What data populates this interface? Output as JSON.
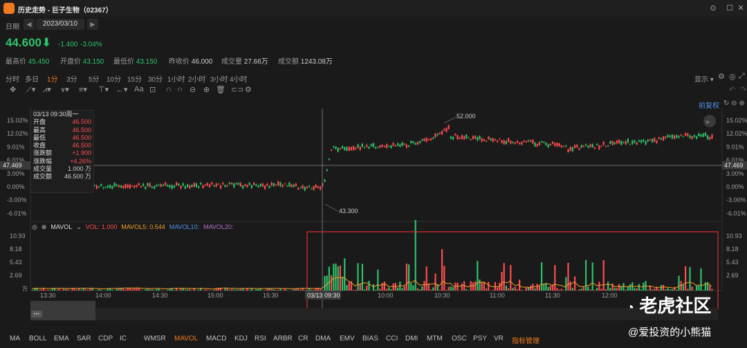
{
  "window": {
    "title": "历史走势 - 巨子生物（02367）"
  },
  "date_bar": {
    "label": "日期",
    "date": "2023/03/10"
  },
  "quote": {
    "price": "44.600",
    "change": "-1.400",
    "change_pct": "-3.04%",
    "stats": [
      {
        "label": "最高价",
        "value": "45.450"
      },
      {
        "label": "开盘价",
        "value": "43.150"
      },
      {
        "label": "最低价",
        "value": "43.150"
      },
      {
        "label": "昨收价",
        "value": "46.000"
      },
      {
        "label": "成交量",
        "value": "27.66万"
      },
      {
        "label": "成交额",
        "value": "1243.08万"
      }
    ]
  },
  "timeframes": [
    "分时",
    "多日",
    "1分",
    "3分",
    "5分",
    "10分",
    "15分",
    "30分",
    "1小时",
    "2小时",
    "3小时",
    "4小时"
  ],
  "active_timeframe": "1分",
  "display_label": "显示",
  "fuquan_label": "前复权",
  "chart": {
    "y_axis_labels": [
      "15.02%",
      "12.02%",
      "9.01%",
      "6.01%",
      "3.00%",
      "0.00%",
      "-3.00%",
      "-6.01%"
    ],
    "crosshair_value": "47.469",
    "high_annotation": "52.000",
    "low_annotation": "43.300",
    "info_panel": [
      {
        "label": "03/13 09:30周一",
        "value": ""
      },
      {
        "label": "开盘",
        "value": "46.500"
      },
      {
        "label": "最高",
        "value": "46.500"
      },
      {
        "label": "最低",
        "value": "46.500"
      },
      {
        "label": "收盘",
        "value": "46.500"
      },
      {
        "label": "涨跌额",
        "value": "+1.900"
      },
      {
        "label": "涨跌幅",
        "value": "+4.26%"
      },
      {
        "label": "成交量",
        "value": "1.000 万"
      },
      {
        "label": "成交额",
        "value": "46.500 万"
      }
    ]
  },
  "volume": {
    "legend_name": "MAVOL",
    "vol": "VOL: 1.000",
    "mavol5": "MAVOL5: 0.544",
    "mavol10": "MAVOL10:",
    "mavol20": "MAVOL20:",
    "y_axis_labels": [
      "10.93",
      "8.18",
      "5.43",
      "2.69"
    ],
    "unit": "万"
  },
  "time_axis": [
    "13:30",
    "14:00",
    "14:30",
    "15:00",
    "15:30",
    "03/13 09:30",
    "10:00",
    "10:30",
    "11:00",
    "11:30",
    "12:00"
  ],
  "indicators": [
    "MA",
    "BOLL",
    "EMA",
    "SAR",
    "CDP",
    "IC",
    "WMSR",
    "MAVOL",
    "MACD",
    "KDJ",
    "RSI",
    "ARBR",
    "CR",
    "DMA",
    "EMV",
    "BIAS",
    "CCI",
    "DMI",
    "MTM",
    "OSC",
    "PSY",
    "VR",
    "指标管理"
  ],
  "active_indicator": "MAVOL",
  "watermark": {
    "brand": "老虎社区",
    "user": "@爱投资的小熊猫"
  },
  "colors": {
    "up": "#ff4d4f",
    "down": "#2ec26b",
    "accent": "#f07a1e",
    "highlight_box": "#e03030"
  }
}
